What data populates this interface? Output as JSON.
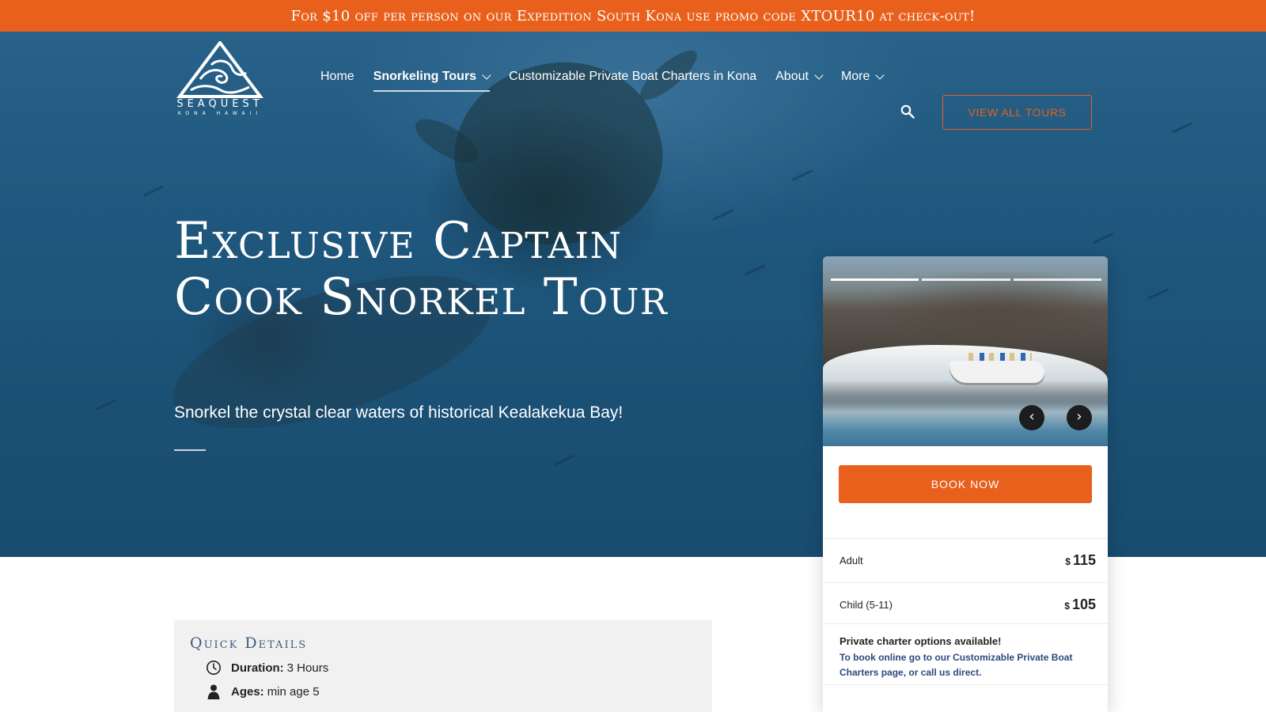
{
  "promo": {
    "text": "For $10 off per person on our Expedition South Kona use promo code XTOUR10 at check-out!"
  },
  "logo": {
    "wordmark": "SEAQUEST",
    "subword": "KONA HAWAII"
  },
  "nav": {
    "items": [
      {
        "label": "Home"
      },
      {
        "label": "Snorkeling Tours"
      },
      {
        "label": "Customizable Private Boat Charters in Kona"
      },
      {
        "label": "About"
      },
      {
        "label": "More"
      }
    ],
    "search_icon": "search-icon",
    "view_all_label": "VIEW ALL TOURS"
  },
  "hero": {
    "title": "Exclusive Captain Cook Snorkel Tour",
    "subtitle": "Snorkel the crystal clear waters of historical Kealakekua Bay!"
  },
  "booking": {
    "gallery": {
      "prev": "‹",
      "next": "›",
      "slides": 3,
      "active_slide": 1
    },
    "book_now_label": "BOOK NOW",
    "prices": [
      {
        "label": "Adult",
        "currency": "$",
        "amount": "115"
      },
      {
        "label": "Child (5-11)",
        "currency": "$",
        "amount": "105"
      }
    ],
    "charter_title": "Private charter options available!",
    "charter_text": "To book online go to our Customizable Private Boat Charters page, or call us direct."
  },
  "quick_details": {
    "title": "Quick Details",
    "items": [
      {
        "icon": "clock-icon",
        "label": "Duration:",
        "value": "3 Hours"
      },
      {
        "icon": "person-icon",
        "label": "Ages:",
        "value": "min age 5"
      }
    ]
  },
  "colors": {
    "accent": "#e8601c",
    "link": "#2c4a7c",
    "heading": "#3f5a7c"
  }
}
